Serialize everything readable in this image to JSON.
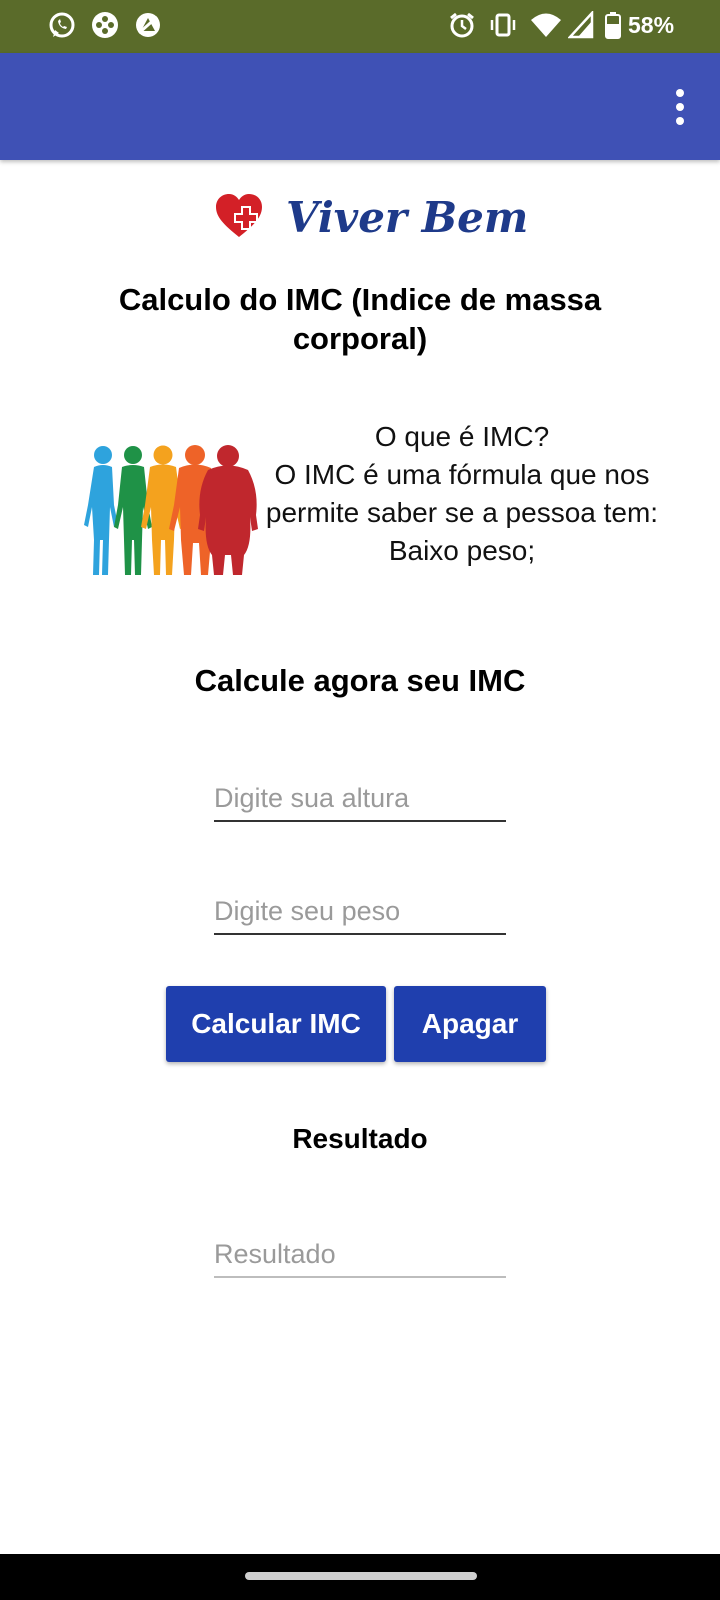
{
  "status_bar": {
    "battery_text": "58%",
    "left_icons": [
      "whatsapp-icon",
      "game-controller-icon",
      "blocked-app-icon"
    ],
    "right_icons": [
      "alarm-icon",
      "vibrate-icon",
      "wifi-icon",
      "cellular-signal-icon",
      "battery-icon"
    ],
    "background": "#5a6b2a"
  },
  "app_bar": {
    "color": "#3f51b5",
    "menu_icon": "more-vert-icon"
  },
  "logo": {
    "text": "Viver Bem",
    "icon": "heart-cross-icon"
  },
  "title": "Calculo do IMC (Indice de massa corporal)",
  "info": {
    "line1": "O que é IMC?",
    "line2": "O IMC é uma fórmula que nos permite saber se a pessoa tem:",
    "line3": "Baixo peso;"
  },
  "calc_heading": "Calcule agora seu IMC",
  "form": {
    "height_placeholder": "Digite sua altura",
    "weight_placeholder": "Digite seu peso",
    "calculate_label": "Calcular IMC",
    "clear_label": "Apagar",
    "button_color": "#1f3fae"
  },
  "result": {
    "heading": "Resultado",
    "placeholder": "Resultado"
  }
}
